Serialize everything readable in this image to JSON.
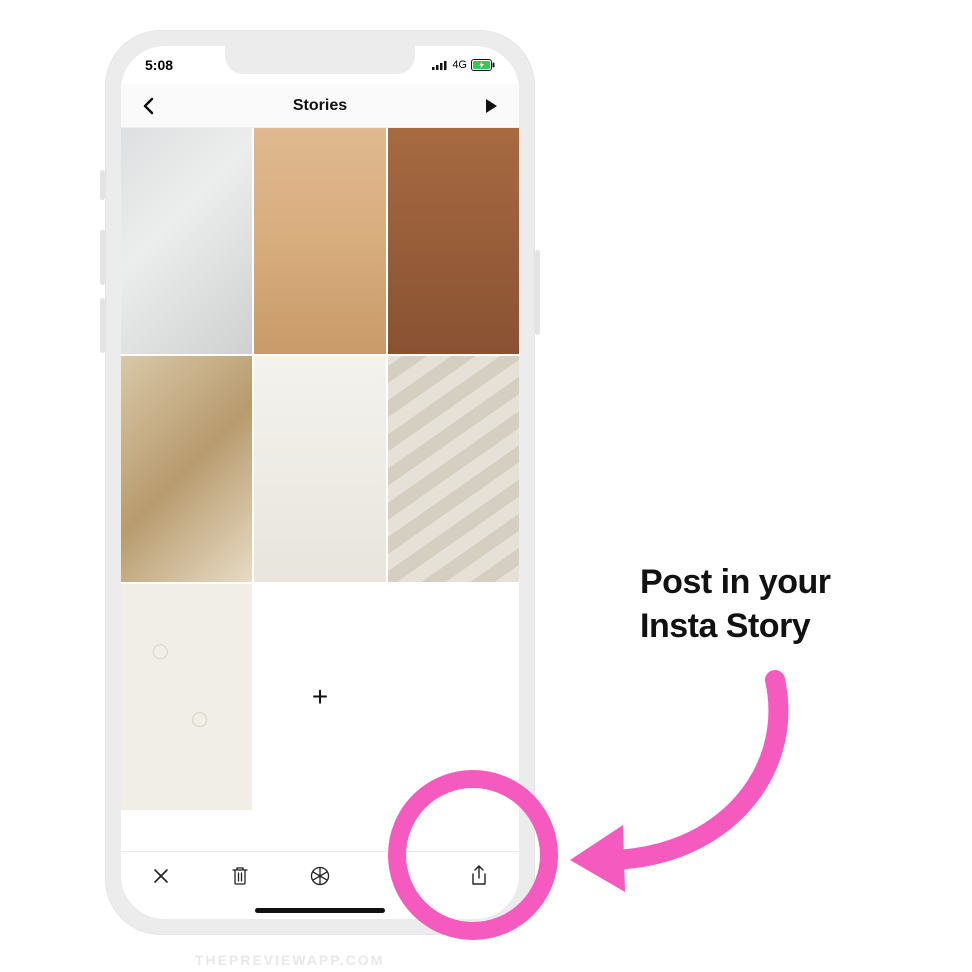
{
  "status": {
    "time": "5:08",
    "network": "4G"
  },
  "nav": {
    "title": "Stories"
  },
  "grid": {
    "add_label": "+"
  },
  "annotation": {
    "line1": "Post in your",
    "line2": "Insta Story"
  },
  "watermark": "THEPREVIEWAPP.COM",
  "colors": {
    "highlight": "#f55bbf"
  }
}
